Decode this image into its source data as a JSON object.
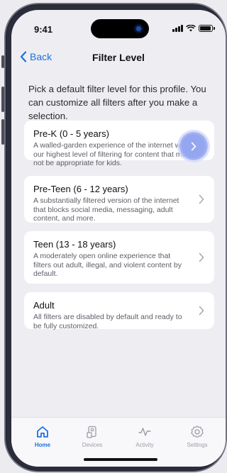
{
  "status_bar": {
    "time": "9:41"
  },
  "nav": {
    "back_label": "Back",
    "title": "Filter Level"
  },
  "intro": "Pick a default filter level for this profile. You can customize all filters after you make a selection.",
  "levels": [
    {
      "title": "Pre-K (0 - 5 years)",
      "description": "A walled-garden experience of the internet with our highest level of filtering for content that may not be appropriate for kids."
    },
    {
      "title": "Pre-Teen (6 - 12 years)",
      "description": "A substantially filtered version of the internet that blocks social media, messaging, adult content, and more."
    },
    {
      "title": "Teen (13 - 18 years)",
      "description": "A moderately open online experience that filters out adult, illegal, and violent content by default."
    },
    {
      "title": "Adult",
      "description": "All filters are disabled by default and ready to be fully customized."
    }
  ],
  "tabs": [
    {
      "label": "Home",
      "icon": "home-icon",
      "active": true
    },
    {
      "label": "Devices",
      "icon": "devices-icon",
      "active": false
    },
    {
      "label": "Activity",
      "icon": "activity-icon",
      "active": false
    },
    {
      "label": "Settings",
      "icon": "settings-icon",
      "active": false
    }
  ],
  "colors": {
    "accent": "#1f6fe0",
    "highlight": "#95a6f0"
  }
}
